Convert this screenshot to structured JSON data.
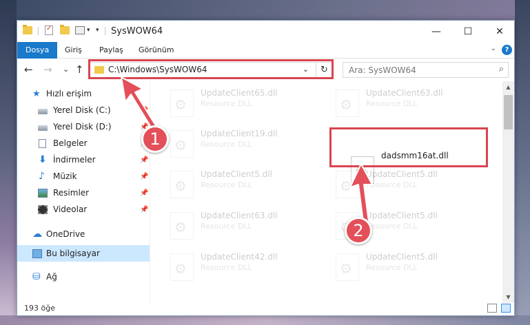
{
  "window": {
    "title": "SysWOW64",
    "minimize": "—",
    "maximize": "☐",
    "close": "✕"
  },
  "ribbon": {
    "tabs": [
      "Dosya",
      "Giriş",
      "Paylaş",
      "Görünüm"
    ],
    "collapse_chevron": "⌄",
    "help": "?"
  },
  "nav": {
    "back": "←",
    "forward": "→",
    "recent": "⌄",
    "up": "↑",
    "address": "C:\\Windows\\SysWOW64",
    "address_dropdown": "⌄",
    "refresh": "↻",
    "search_placeholder": "Ara: SysWOW64",
    "search_icon": "⌕"
  },
  "sidebar": {
    "items": [
      {
        "label": "Hızlı erişim",
        "icon": "star-icon",
        "pinned": false
      },
      {
        "label": "Yerel Disk (C:)",
        "icon": "drive-icon",
        "pinned": true
      },
      {
        "label": "Yerel Disk (D:)",
        "icon": "drive-icon",
        "pinned": true
      },
      {
        "label": "Belgeler",
        "icon": "documents-icon",
        "pinned": true
      },
      {
        "label": "İndirmeler",
        "icon": "download-icon",
        "pinned": true
      },
      {
        "label": "Müzik",
        "icon": "music-icon",
        "pinned": true
      },
      {
        "label": "Resimler",
        "icon": "pictures-icon",
        "pinned": true
      },
      {
        "label": "Videolar",
        "icon": "videos-icon",
        "pinned": true
      },
      {
        "label": "OneDrive",
        "icon": "cloud-icon",
        "pinned": false
      },
      {
        "label": "Bu bilgisayar",
        "icon": "computer-icon",
        "pinned": false
      },
      {
        "label": "Ağ",
        "icon": "network-icon",
        "pinned": false
      }
    ],
    "pin_glyph": "📌"
  },
  "files": [
    {
      "name": "UpdateClient65.dll",
      "desc": "Resource DLL"
    },
    {
      "name": "UpdateClient63.dll",
      "desc": "Resource DLL"
    },
    {
      "name": "UpdateClient19.dll",
      "desc": "Resource DLL"
    },
    {
      "name": "dadsmm16at.dll",
      "desc": ""
    },
    {
      "name": "UpdateClient5.dll",
      "desc": "Resource DLL"
    },
    {
      "name": "UpdateClient5.dll",
      "desc": "Resource DLL"
    },
    {
      "name": "UpdateClient63.dll",
      "desc": "Resource DLL"
    },
    {
      "name": "UpdateClient5.dll",
      "desc": "Resource DLL"
    },
    {
      "name": "UpdateClient42.dll",
      "desc": "Resource DLL"
    },
    {
      "name": "UpdateClient5.dll",
      "desc": "Resource DLL"
    }
  ],
  "status": {
    "count": "193 öğe"
  },
  "annotations": {
    "badge1": "1",
    "badge2": "2"
  },
  "colors": {
    "accent": "#1979ca",
    "highlight": "#d9444f",
    "badge": "#e3505a",
    "selection": "#cce8ff"
  }
}
